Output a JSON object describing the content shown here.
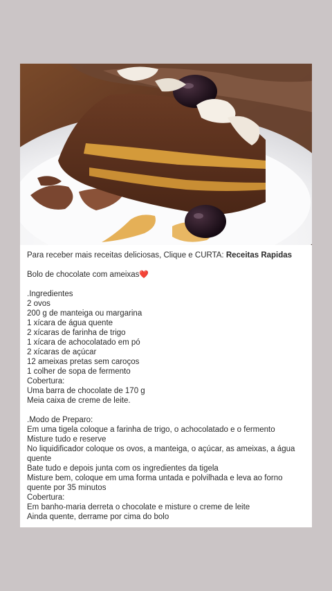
{
  "post": {
    "promo_text": "Para receber mais receitas deliciosas, Clique e CURTA: ",
    "promo_link": "Receitas Rapidas",
    "title": "Bolo de chocolate com ameixas",
    "title_emoji": "❤️",
    "ingredients_heading": ".Ingredientes",
    "ingredients": [
      "2 ovos",
      "200 g de manteiga ou margarina",
      "1 xícara de água quente",
      "2 xícaras de farinha de trigo",
      "1 xícara de achocolatado em pó",
      "2 xícaras de açúcar",
      "12 ameixas pretas sem caroços",
      "1 colher de sopa de fermento"
    ],
    "topping_heading": "Cobertura:",
    "topping_ingredients": [
      "Uma barra de chocolate de 170 g",
      "Meia caixa de creme de leite."
    ],
    "method_heading": ".Modo de Preparo:",
    "method_steps": [
      "Em uma tigela coloque a farinha de trigo, o achocolatado e o fermento",
      "Misture tudo e reserve",
      "No liquidificador coloque os ovos, a manteiga, o açúcar, as ameixas, a água quente",
      "Bate tudo e depois junta com os ingredientes da tigela",
      "Misture bem, coloque em uma forma untada e polvilhada e leva ao forno quente por 35 minutos"
    ],
    "topping_method_heading": "Cobertura:",
    "topping_method_steps": [
      "Em banho-maria derreta o chocolate e misture o creme de leite",
      "Ainda quente, derrame por cima do bolo"
    ]
  }
}
